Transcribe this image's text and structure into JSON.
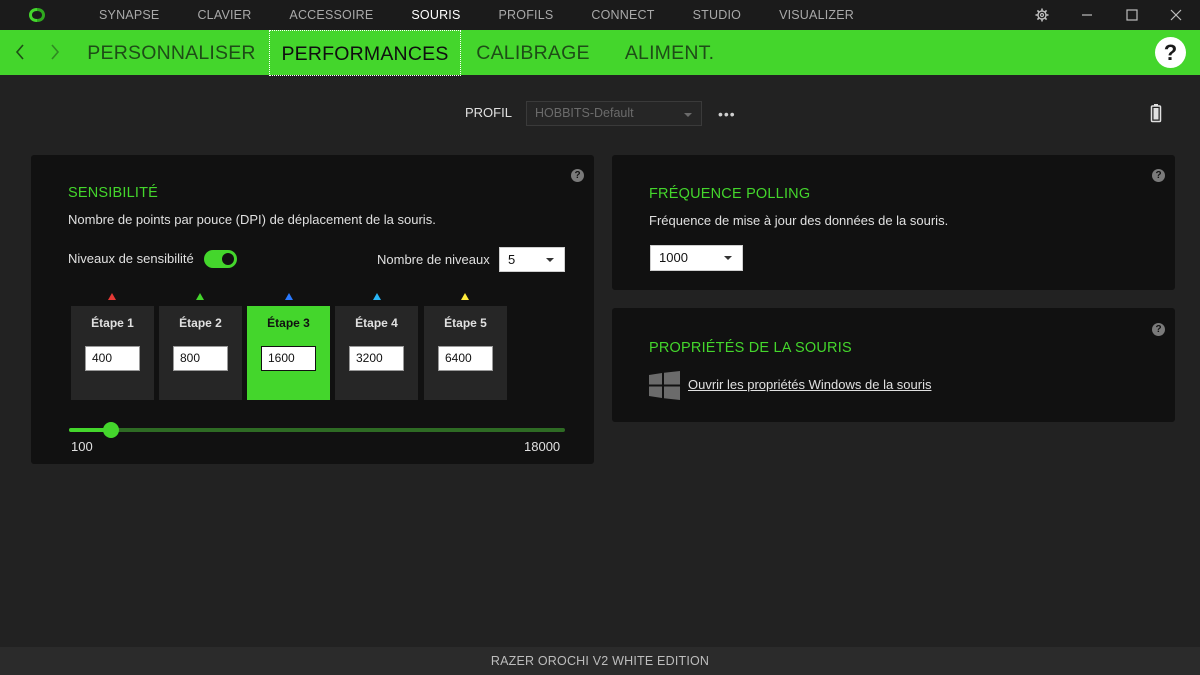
{
  "topnav": {
    "items": [
      "SYNAPSE",
      "CLAVIER",
      "ACCESSOIRE",
      "SOURIS",
      "PROFILS",
      "CONNECT",
      "STUDIO",
      "VISUALIZER"
    ],
    "active": "SOURIS"
  },
  "subnav": {
    "tabs": [
      "PERSONNALISER",
      "PERFORMANCES",
      "CALIBRAGE",
      "ALIMENT."
    ],
    "active": "PERFORMANCES",
    "help": "?"
  },
  "profile": {
    "label": "PROFIL",
    "value": "HOBBITS-Default",
    "more": "•••"
  },
  "sensitivity": {
    "title": "SENSIBILITÉ",
    "description": "Nombre de points par pouce (DPI) de déplacement de la souris.",
    "levels_label": "Niveaux de sensibilité",
    "levels_enabled": true,
    "count_label": "Nombre de niveaux",
    "count_value": "5",
    "stages": [
      {
        "label": "Étape 1",
        "value": "400",
        "color": "#e53935"
      },
      {
        "label": "Étape 2",
        "value": "800",
        "color": "#44d62c"
      },
      {
        "label": "Étape 3",
        "value": "1600",
        "color": "#2979ff"
      },
      {
        "label": "Étape 4",
        "value": "3200",
        "color": "#29b6f6"
      },
      {
        "label": "Étape 5",
        "value": "6400",
        "color": "#ffeb3b"
      }
    ],
    "active_stage": 2,
    "slider": {
      "min": 100,
      "max": 18000,
      "value": 1600,
      "min_label": "100",
      "max_label": "18000"
    },
    "help": "?"
  },
  "polling": {
    "title": "FRÉQUENCE POLLING",
    "description": "Fréquence de mise à jour des données de la souris.",
    "value": "1000",
    "help": "?"
  },
  "mouse_props": {
    "title": "PROPRIÉTÉS DE LA SOURIS",
    "link": "Ouvrir les propriétés Windows de la souris",
    "help": "?"
  },
  "footer": {
    "device": "RAZER OROCHI V2 WHITE EDITION"
  },
  "colors": {
    "accent": "#44d62c",
    "background": "#222222",
    "card": "#111111"
  }
}
